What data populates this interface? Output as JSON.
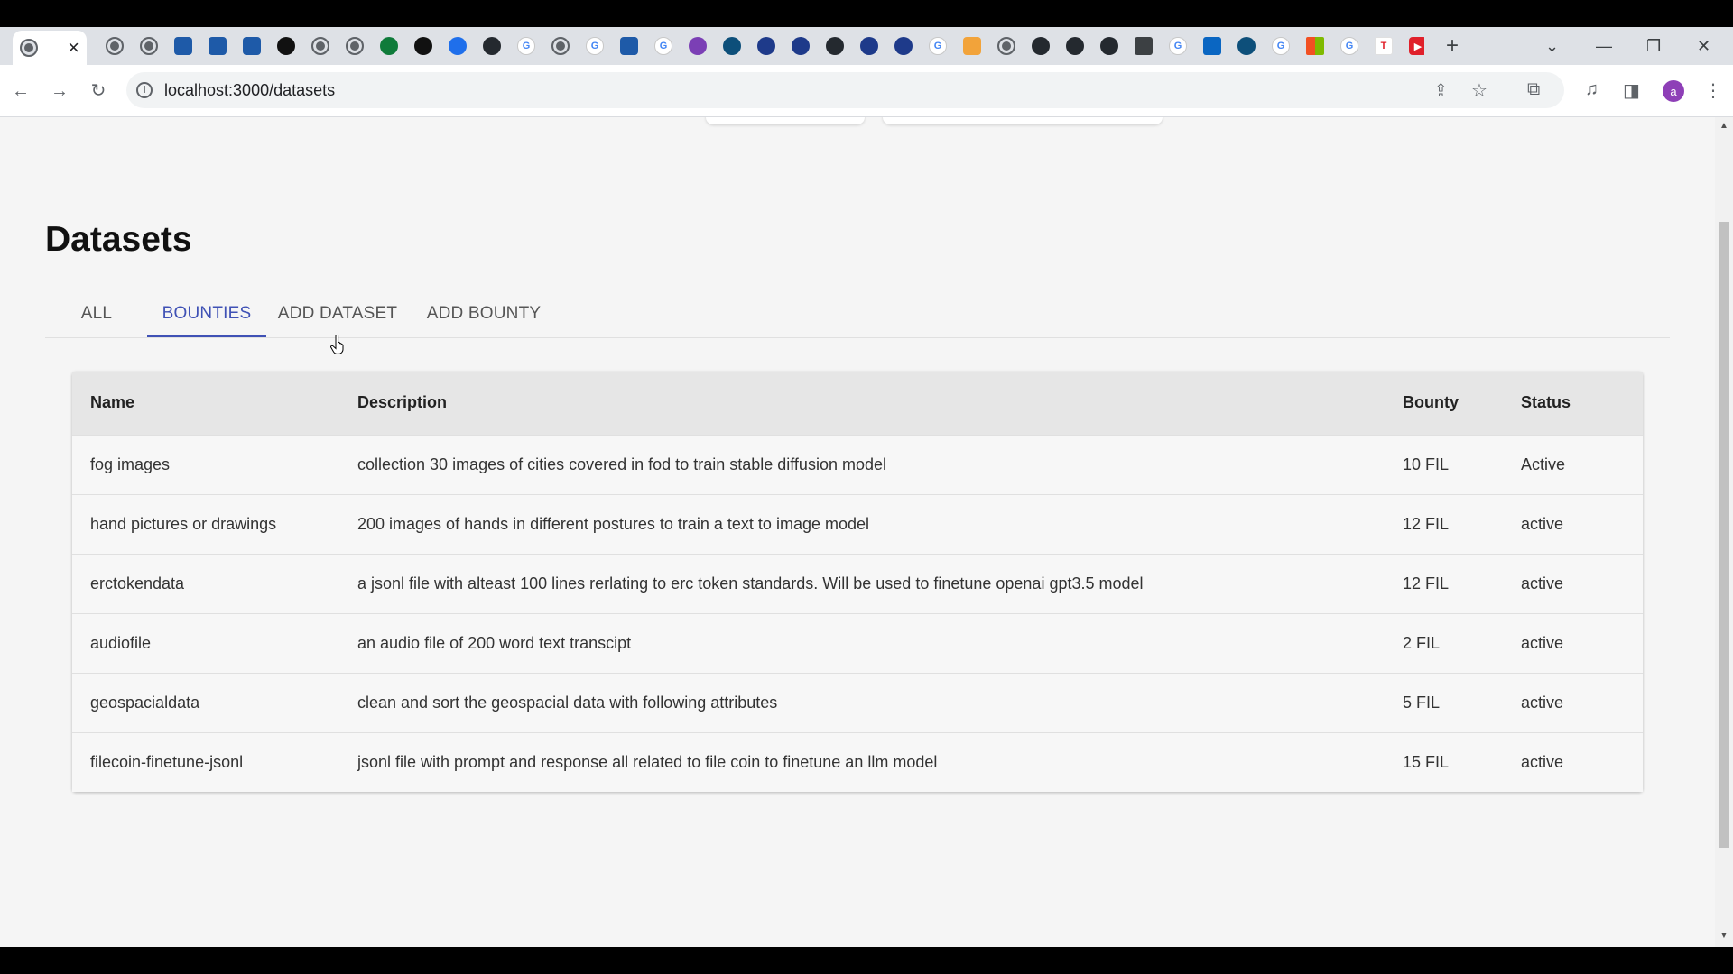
{
  "browser": {
    "active_tab_close": "×",
    "tab_favicons": [
      "globe",
      "globe",
      "wave",
      "wave",
      "wave",
      "dark",
      "globe",
      "globe",
      "green",
      "dark",
      "blue",
      "gh",
      "g",
      "globe",
      "g",
      "wave",
      "g",
      "purple",
      "teal",
      "navy",
      "navy",
      "gh",
      "navy",
      "navy",
      "g",
      "orange",
      "globe",
      "gh",
      "gh",
      "gh",
      "book",
      "g",
      "lin",
      "teal",
      "g",
      "ms",
      "g",
      "tee",
      "red"
    ],
    "new_tab": "+",
    "url": "localhost:3000/datasets",
    "profile_initial": "a"
  },
  "page": {
    "title": "Datasets",
    "tabs": [
      {
        "label": "ALL",
        "active": false
      },
      {
        "label": "BOUNTIES",
        "active": true
      },
      {
        "label": "ADD DATASET",
        "active": false
      },
      {
        "label": "ADD BOUNTY",
        "active": false
      }
    ],
    "table": {
      "headers": {
        "name": "Name",
        "description": "Description",
        "bounty": "Bounty",
        "status": "Status"
      },
      "rows": [
        {
          "name": "fog images",
          "description": "collection 30 images of cities covered in fod to train stable diffusion model",
          "bounty": "10 FIL",
          "status": "Active"
        },
        {
          "name": "hand pictures or drawings",
          "description": "200 images of hands in different postures to train a text to image model",
          "bounty": "12 FIL",
          "status": "active"
        },
        {
          "name": "erctokendata",
          "description": "a jsonl file with alteast 100 lines rerlating to erc token standards. Will be used to finetune openai gpt3.5 model",
          "bounty": "12 FIL",
          "status": "active"
        },
        {
          "name": "audiofile",
          "description": "an audio file of 200 word text transcipt",
          "bounty": "2 FIL",
          "status": "active"
        },
        {
          "name": "geospacialdata",
          "description": "clean and sort the geospacial data with following attributes",
          "bounty": "5 FIL",
          "status": "active"
        },
        {
          "name": "filecoin-finetune-jsonl",
          "description": "jsonl file with prompt and response all related to file coin to finetune an llm model",
          "bounty": "15 FIL",
          "status": "active"
        }
      ]
    }
  },
  "colors": {
    "accent": "#3f51b5",
    "page_bg": "#f5f5f5",
    "header_bg": "#e6e6e6"
  }
}
